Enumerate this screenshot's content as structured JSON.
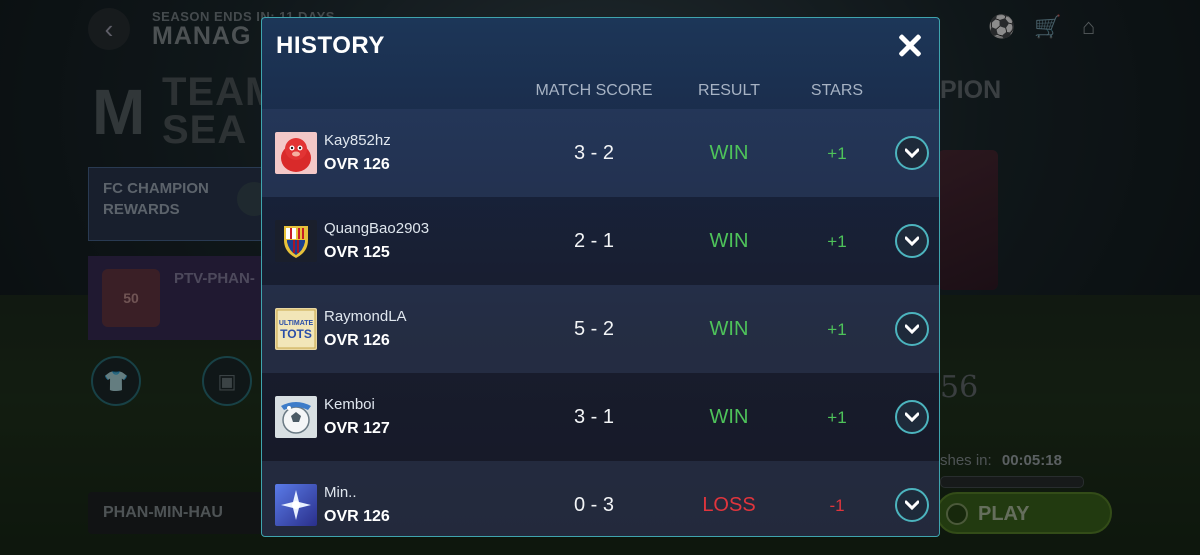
{
  "background": {
    "season_ends": "SEASON ENDS IN: 11 DAYS",
    "mode_title": "MANAG",
    "team_line1": "TEAM",
    "team_line2": "SEA",
    "rewards_label_1": "FC CHAMPION",
    "rewards_label_2": "REWARDS",
    "player_card_name": "PTV-PHAN-",
    "player_card_badge": "50",
    "champion_label": "PION",
    "big_number": "56",
    "refresh_label": "shes in:",
    "refresh_timer": "00:05:18",
    "username": "PHAN-MIN-HAU",
    "play_label": "PLAY"
  },
  "modal": {
    "title": "HISTORY",
    "columns": {
      "match_score": "MATCH SCORE",
      "result": "RESULT",
      "stars": "STARS"
    },
    "rows": [
      {
        "name": "Kay852hz",
        "ovr": "OVR 126",
        "score": "3 - 2",
        "result": "WIN",
        "stars": "+1",
        "avatar": "red-mascot-icon",
        "result_color": "#4ec35a"
      },
      {
        "name": "QuangBao2903",
        "ovr": "OVR 125",
        "score": "2 - 1",
        "result": "WIN",
        "stars": "+1",
        "avatar": "barcelona-crest-icon",
        "result_color": "#4ec35a"
      },
      {
        "name": "RaymondLA",
        "ovr": "OVR 126",
        "score": "5 - 2",
        "result": "WIN",
        "stars": "+1",
        "avatar": "ultimate-tots-icon",
        "result_color": "#4ec35a"
      },
      {
        "name": "Kemboi",
        "ovr": "OVR 127",
        "score": "3 - 1",
        "result": "WIN",
        "stars": "+1",
        "avatar": "ball-mascot-icon",
        "result_color": "#4ec35a"
      },
      {
        "name": "Min..",
        "ovr": "OVR 126",
        "score": "0 - 3",
        "result": "LOSS",
        "stars": "-1",
        "avatar": "star-burst-icon",
        "result_color": "#e0353d"
      }
    ]
  },
  "ui_text": {
    "ultimate": "ULTIMATE",
    "tots": "TOTS"
  }
}
